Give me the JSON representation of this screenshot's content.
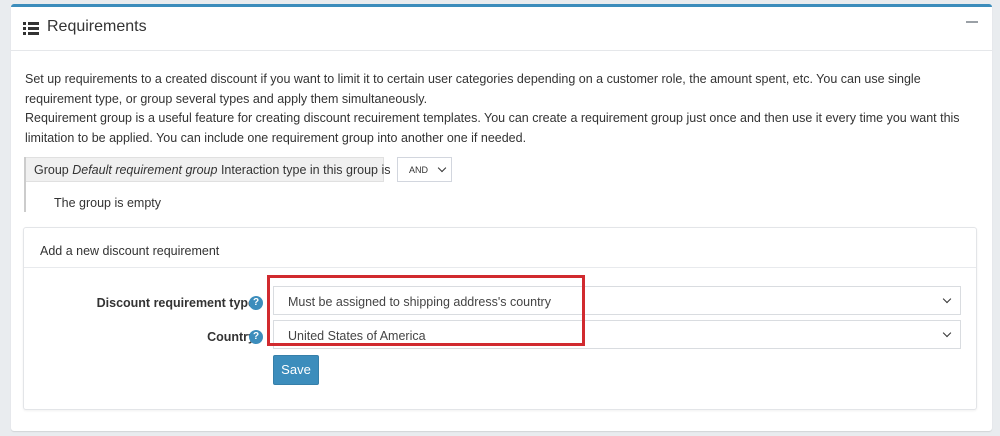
{
  "card": {
    "title": "Requirements",
    "title_icon": "list-icon",
    "collapse_icon": "minus-icon"
  },
  "intro": {
    "line1": "Set up requirements to a created discount if you want to limit it to certain user categories depending on a customer role, the amount spent, etc. You can use single requirement type, or group several types and apply them simultaneously.",
    "line2": "Requirement group is a useful feature for creating discount recuirement templates. You can create a requirement group just once and then use it every time you want this limitation to be applied. You can include one requirement group into another one if needed."
  },
  "group": {
    "prefix": "Group",
    "name": "Default requirement group",
    "interaction_label": "Interaction type in this group is",
    "interaction_value": "AND",
    "empty_text": "The group is empty"
  },
  "add_requirement": {
    "title": "Add a new discount requirement",
    "type_label": "Discount requirement type",
    "type_value": "Must be assigned to shipping address's country",
    "country_label": "Country",
    "country_value": "United States of America",
    "save_label": "Save",
    "help_icon": "question-circle-icon"
  },
  "colors": {
    "accent": "#3c8dbc",
    "highlight": "#d12a2f"
  }
}
